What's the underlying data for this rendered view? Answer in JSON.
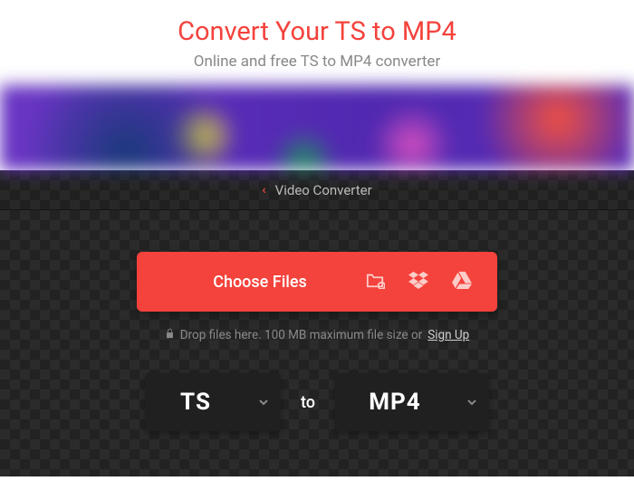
{
  "header": {
    "title": "Convert Your TS to MP4",
    "subtitle": "Online and free TS to MP4 converter"
  },
  "breadcrumb": {
    "label": "Video Converter"
  },
  "upload": {
    "choose_label": "Choose Files",
    "hint_prefix": "Drop files here. 100 MB maximum file size or",
    "signup_label": "Sign Up"
  },
  "formats": {
    "from": "TS",
    "to_text": "to",
    "to": "MP4"
  }
}
